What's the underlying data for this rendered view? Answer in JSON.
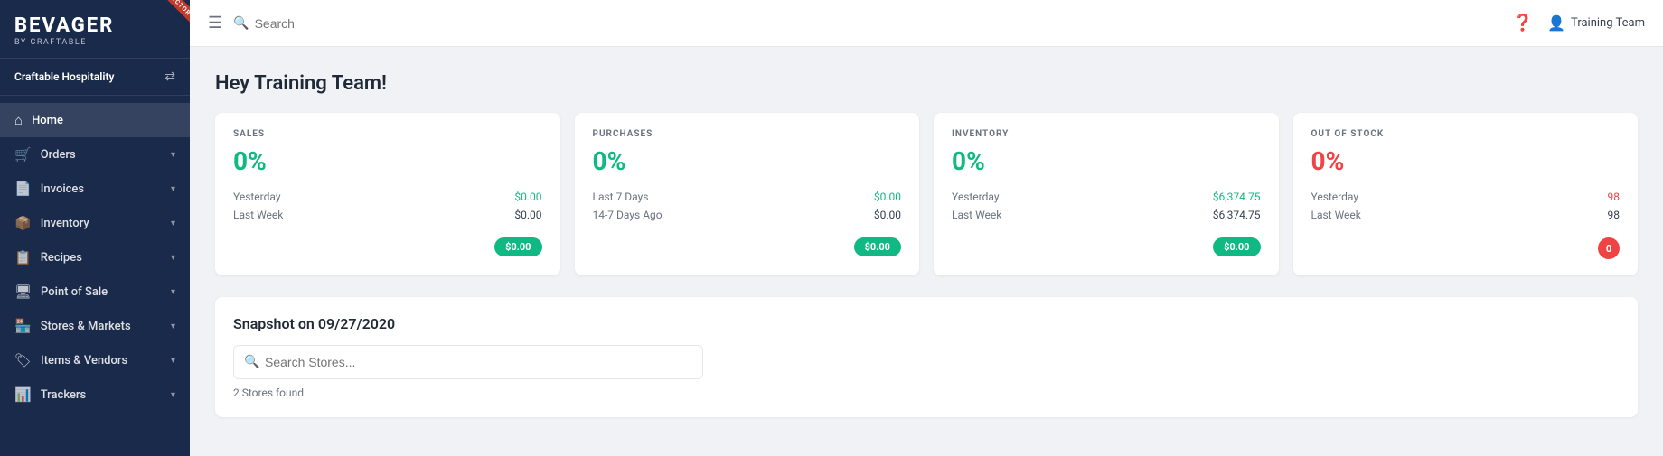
{
  "sidebar": {
    "logo": "BEVAGER",
    "logo_sub": "BY CRAFTABLE",
    "director_badge": "DIRECTOR",
    "org_name": "Craftable Hospitality",
    "nav_items": [
      {
        "id": "home",
        "label": "Home",
        "icon": "⌂",
        "active": true,
        "has_chevron": false
      },
      {
        "id": "orders",
        "label": "Orders",
        "icon": "🛒",
        "active": false,
        "has_chevron": true
      },
      {
        "id": "invoices",
        "label": "Invoices",
        "icon": "📄",
        "active": false,
        "has_chevron": true
      },
      {
        "id": "inventory",
        "label": "Inventory",
        "icon": "📦",
        "active": false,
        "has_chevron": true
      },
      {
        "id": "recipes",
        "label": "Recipes",
        "icon": "📋",
        "active": false,
        "has_chevron": true
      },
      {
        "id": "point-of-sale",
        "label": "Point of Sale",
        "icon": "🖥",
        "active": false,
        "has_chevron": true
      },
      {
        "id": "stores-markets",
        "label": "Stores & Markets",
        "icon": "🏪",
        "active": false,
        "has_chevron": true
      },
      {
        "id": "items-vendors",
        "label": "Items & Vendors",
        "icon": "🏷",
        "active": false,
        "has_chevron": true
      },
      {
        "id": "trackers",
        "label": "Trackers",
        "icon": "📊",
        "active": false,
        "has_chevron": true
      }
    ]
  },
  "header": {
    "search_placeholder": "Search",
    "user_name": "Training Team"
  },
  "content": {
    "greeting": "Hey Training Team!",
    "stats": [
      {
        "id": "sales",
        "label": "SALES",
        "value": "0%",
        "color": "green",
        "rows": [
          {
            "label": "Yesterday",
            "value": "$0.00",
            "color": "green"
          },
          {
            "label": "Last Week",
            "value": "$0.00",
            "color": "default"
          }
        ],
        "badge": "$0.00",
        "badge_color": "green"
      },
      {
        "id": "purchases",
        "label": "PURCHASES",
        "value": "0%",
        "color": "green",
        "rows": [
          {
            "label": "Last 7 Days",
            "value": "$0.00",
            "color": "green"
          },
          {
            "label": "14-7 Days Ago",
            "value": "$0.00",
            "color": "default"
          }
        ],
        "badge": "$0.00",
        "badge_color": "green"
      },
      {
        "id": "inventory",
        "label": "INVENTORY",
        "value": "0%",
        "color": "green",
        "rows": [
          {
            "label": "Yesterday",
            "value": "$6,374.75",
            "color": "green"
          },
          {
            "label": "Last Week",
            "value": "$6,374.75",
            "color": "default"
          }
        ],
        "badge": "$0.00",
        "badge_color": "green"
      },
      {
        "id": "out-of-stock",
        "label": "OUT OF STOCK",
        "value": "0%",
        "color": "red",
        "rows": [
          {
            "label": "Yesterday",
            "value": "98",
            "color": "red"
          },
          {
            "label": "Last Week",
            "value": "98",
            "color": "default"
          }
        ],
        "badge": "0",
        "badge_color": "red"
      }
    ],
    "snapshot": {
      "title": "Snapshot on 09/27/2020",
      "search_placeholder": "Search Stores...",
      "stores_found": "2 Stores found"
    }
  }
}
